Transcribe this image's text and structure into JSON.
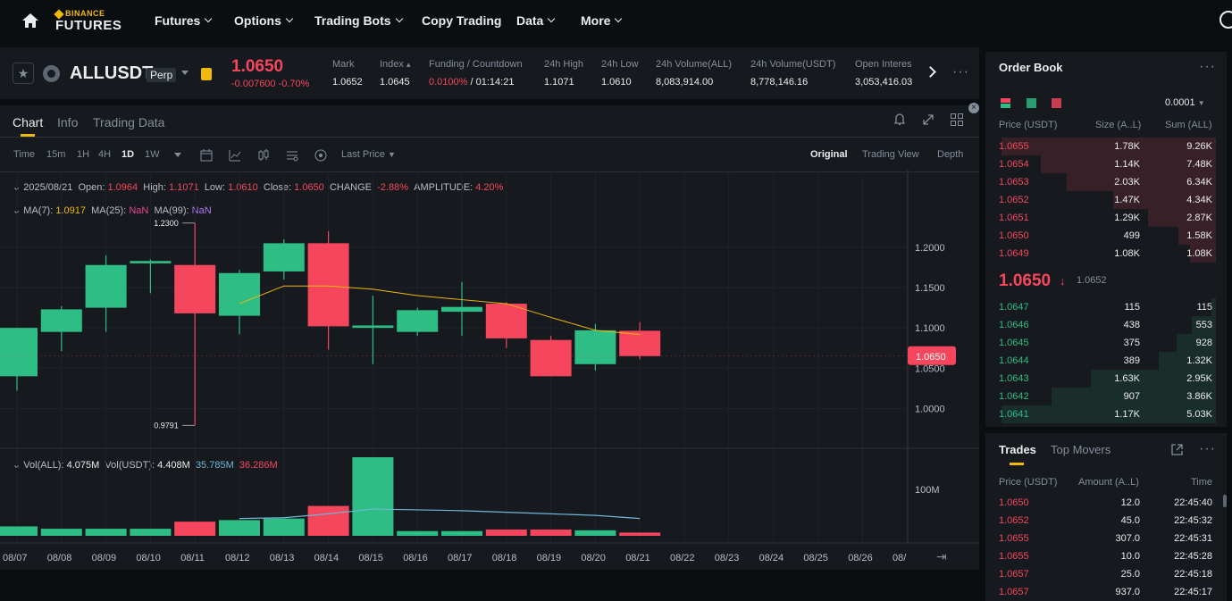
{
  "nav": {
    "brand_top": "BINANCE",
    "brand_bottom": "FUTURES",
    "items": [
      {
        "label": "Futures",
        "dropdown": true
      },
      {
        "label": "Options",
        "dropdown": true
      },
      {
        "label": "Trading Bots",
        "dropdown": true
      },
      {
        "label": "Copy Trading",
        "dropdown": false
      },
      {
        "label": "Data",
        "dropdown": true
      },
      {
        "label": "More",
        "dropdown": true
      }
    ]
  },
  "ticker": {
    "symbol": "ALLUSDT",
    "contract": "Perp",
    "last_price": "1.0650",
    "change": "-0.007600 -0.70%",
    "stats": [
      {
        "label": "Mark",
        "value": "1.0652"
      },
      {
        "label": "Index",
        "value": "1.0645"
      },
      {
        "label": "Funding / Countdown",
        "value": "0.0100%",
        "value2": "/ 01:14:21"
      },
      {
        "label": "24h High",
        "value": "1.1071"
      },
      {
        "label": "24h Low",
        "value": "1.0610"
      },
      {
        "label": "24h Volume(ALL)",
        "value": "8,083,914.00"
      },
      {
        "label": "24h Volume(USDT)",
        "value": "8,778,146.16"
      },
      {
        "label": "Open Interes",
        "value": "3,053,416.03"
      }
    ]
  },
  "chart_tabs": [
    "Chart",
    "Info",
    "Trading Data"
  ],
  "timeframes": [
    "Time",
    "15m",
    "1H",
    "4H",
    "1D",
    "1W"
  ],
  "active_timeframe": "1D",
  "price_type": "Last Price",
  "views": [
    "Original",
    "Trading View",
    "Depth"
  ],
  "ohlc": {
    "date": "2025/08/21",
    "open_label": "Open:",
    "open": "1.0964",
    "high_label": "High:",
    "high": "1.1071",
    "low_label": "Low:",
    "low": "1.0610",
    "close_label": "Close:",
    "close": "1.0650",
    "change_label": "CHANGE:",
    "change": "-2.88%",
    "amp_label": "AMPLITUDE:",
    "amp": "4.20%"
  },
  "ma": {
    "ma7_label": "MA(7):",
    "ma7": "1.0917",
    "ma25_label": "MA(25):",
    "ma25": "NaN",
    "ma99_label": "MA(99):",
    "ma99": "NaN"
  },
  "volume": {
    "all_label": "Vol(ALL):",
    "all": "4.075M",
    "usdt_label": "Vol(USDT):",
    "usdt": "4.408M",
    "ma1": "35.785M",
    "ma2": "36.286M"
  },
  "chart_data": {
    "type": "candlestick",
    "categories": [
      "08/07",
      "08/08",
      "08/09",
      "08/10",
      "08/11",
      "08/12",
      "08/13",
      "08/14",
      "08/15",
      "08/16",
      "08/17",
      "08/18",
      "08/19",
      "08/20",
      "08/21"
    ],
    "x_axis_labels": [
      "08/07",
      "08/08",
      "08/09",
      "08/10",
      "08/11",
      "08/12",
      "08/13",
      "08/14",
      "08/15",
      "08/16",
      "08/17",
      "08/18",
      "08/19",
      "08/20",
      "08/21",
      "08/22",
      "08/23",
      "08/24",
      "08/25",
      "08/26",
      "08/"
    ],
    "open": [
      1.04,
      1.095,
      1.125,
      1.18,
      1.178,
      1.115,
      1.17,
      1.205,
      1.1,
      1.095,
      1.12,
      1.13,
      1.085,
      1.055,
      1.0964
    ],
    "high": [
      1.1,
      1.127,
      1.19,
      1.185,
      1.23,
      1.172,
      1.21,
      1.22,
      1.14,
      1.125,
      1.157,
      1.132,
      1.09,
      1.105,
      1.1071
    ],
    "low": [
      1.022,
      1.071,
      1.095,
      1.143,
      0.9791,
      1.092,
      1.16,
      1.073,
      1.055,
      1.09,
      1.09,
      1.075,
      1.04,
      1.047,
      1.061
    ],
    "close": [
      1.1,
      1.123,
      1.178,
      1.183,
      1.118,
      1.168,
      1.205,
      1.102,
      1.103,
      1.122,
      1.126,
      1.087,
      1.04,
      1.097,
      1.065
    ],
    "ma7": [
      null,
      null,
      null,
      null,
      null,
      1.13,
      1.152,
      1.152,
      1.148,
      1.14,
      1.135,
      1.13,
      1.113,
      1.097,
      1.0917
    ],
    "volume": [
      12,
      9,
      9,
      9,
      18,
      20,
      22,
      38,
      100,
      6,
      6,
      8,
      8,
      7,
      4.075
    ],
    "volume_ma": [
      null,
      null,
      null,
      null,
      null,
      22,
      23,
      28,
      34,
      33,
      32,
      30,
      28,
      26,
      22
    ],
    "y_ticks": [
      "1.2000",
      "1.1500",
      "1.1000",
      "1.0500",
      "1.0000"
    ],
    "y_range": [
      0.975,
      1.232
    ],
    "hi_label": "1.2300",
    "lo_label": "0.9791",
    "price_tag": "1.0650",
    "vol_tick": "100M"
  },
  "orderbook": {
    "title": "Order Book",
    "tick": "0.0001",
    "headers": [
      "Price (USDT)",
      "Size (A..L)",
      "Sum (ALL)"
    ],
    "asks": [
      {
        "p": "1.0655",
        "s": "1.78K",
        "t": "9.26K",
        "depth": 0.98
      },
      {
        "p": "1.0654",
        "s": "1.14K",
        "t": "7.48K",
        "depth": 0.8
      },
      {
        "p": "1.0653",
        "s": "2.03K",
        "t": "6.34K",
        "depth": 0.68
      },
      {
        "p": "1.0652",
        "s": "1.47K",
        "t": "4.34K",
        "depth": 0.47
      },
      {
        "p": "1.0651",
        "s": "1.29K",
        "t": "2.87K",
        "depth": 0.31
      },
      {
        "p": "1.0650",
        "s": "499",
        "t": "1.58K",
        "depth": 0.17
      },
      {
        "p": "1.0649",
        "s": "1.08K",
        "t": "1.08K",
        "depth": 0.12
      }
    ],
    "mid_price": "1.0650",
    "mid_mark": "1.0652",
    "bids": [
      {
        "p": "1.0647",
        "s": "115",
        "t": "115",
        "depth": 0.02
      },
      {
        "p": "1.0646",
        "s": "438",
        "t": "553",
        "depth": 0.11
      },
      {
        "p": "1.0645",
        "s": "375",
        "t": "928",
        "depth": 0.18
      },
      {
        "p": "1.0644",
        "s": "389",
        "t": "1.32K",
        "depth": 0.26
      },
      {
        "p": "1.0643",
        "s": "1.63K",
        "t": "2.95K",
        "depth": 0.57
      },
      {
        "p": "1.0642",
        "s": "907",
        "t": "3.86K",
        "depth": 0.75
      },
      {
        "p": "1.0641",
        "s": "1.17K",
        "t": "5.03K",
        "depth": 0.98
      }
    ]
  },
  "trades": {
    "tab_active": "Trades",
    "tab_other": "Top Movers",
    "headers": [
      "Price (USDT)",
      "Amount (A..L)",
      "Time"
    ],
    "rows": [
      {
        "p": "1.0650",
        "a": "12.0",
        "t": "22:45:40"
      },
      {
        "p": "1.0652",
        "a": "45.0",
        "t": "22:45:32"
      },
      {
        "p": "1.0655",
        "a": "307.0",
        "t": "22:45:31"
      },
      {
        "p": "1.0655",
        "a": "10.0",
        "t": "22:45:28"
      },
      {
        "p": "1.0657",
        "a": "25.0",
        "t": "22:45:18"
      },
      {
        "p": "1.0657",
        "a": "937.0",
        "t": "22:45:17"
      }
    ]
  },
  "colors": {
    "up": "#2ebd85",
    "down": "#f6465d",
    "accent": "#f0b90b",
    "ma7": "#f0b90b",
    "vol_ma": "#6fb6d8"
  }
}
